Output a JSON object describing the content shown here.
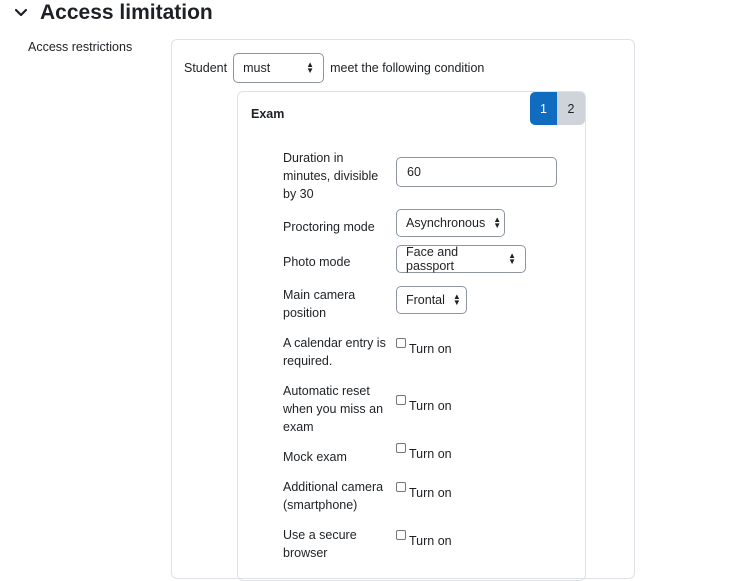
{
  "section": {
    "title": "Access limitation",
    "icon": "chevron-down-icon"
  },
  "field_label": "Access restrictions",
  "condition": {
    "prefix": "Student",
    "mode_value": "must",
    "suffix": "meet the following condition"
  },
  "exam": {
    "title": "Exam",
    "pages": [
      "1",
      "2"
    ],
    "active_page": "1",
    "duration": {
      "label": "Duration in minutes, divisible by 30",
      "value": "60"
    },
    "proctoring": {
      "label": "Proctoring mode",
      "value": "Asynchronous"
    },
    "photo": {
      "label": "Photo mode",
      "value": "Face and passport"
    },
    "camera": {
      "label": "Main camera position",
      "value": "Frontal"
    },
    "checkboxes": [
      {
        "label": "A calendar entry is required.",
        "option": "Turn on"
      },
      {
        "label": "Automatic reset when you miss an exam",
        "option": "Turn on"
      },
      {
        "label": "Mock exam",
        "option": "Turn on"
      },
      {
        "label": "Additional camera (smartphone)",
        "option": "Turn on"
      },
      {
        "label": "Use a secure browser",
        "option": "Turn on"
      }
    ]
  },
  "colors": {
    "accent": "#0f6cbf",
    "inactive_page": "#ced4da",
    "border": "#dee2e6",
    "text": "#1d2125"
  }
}
